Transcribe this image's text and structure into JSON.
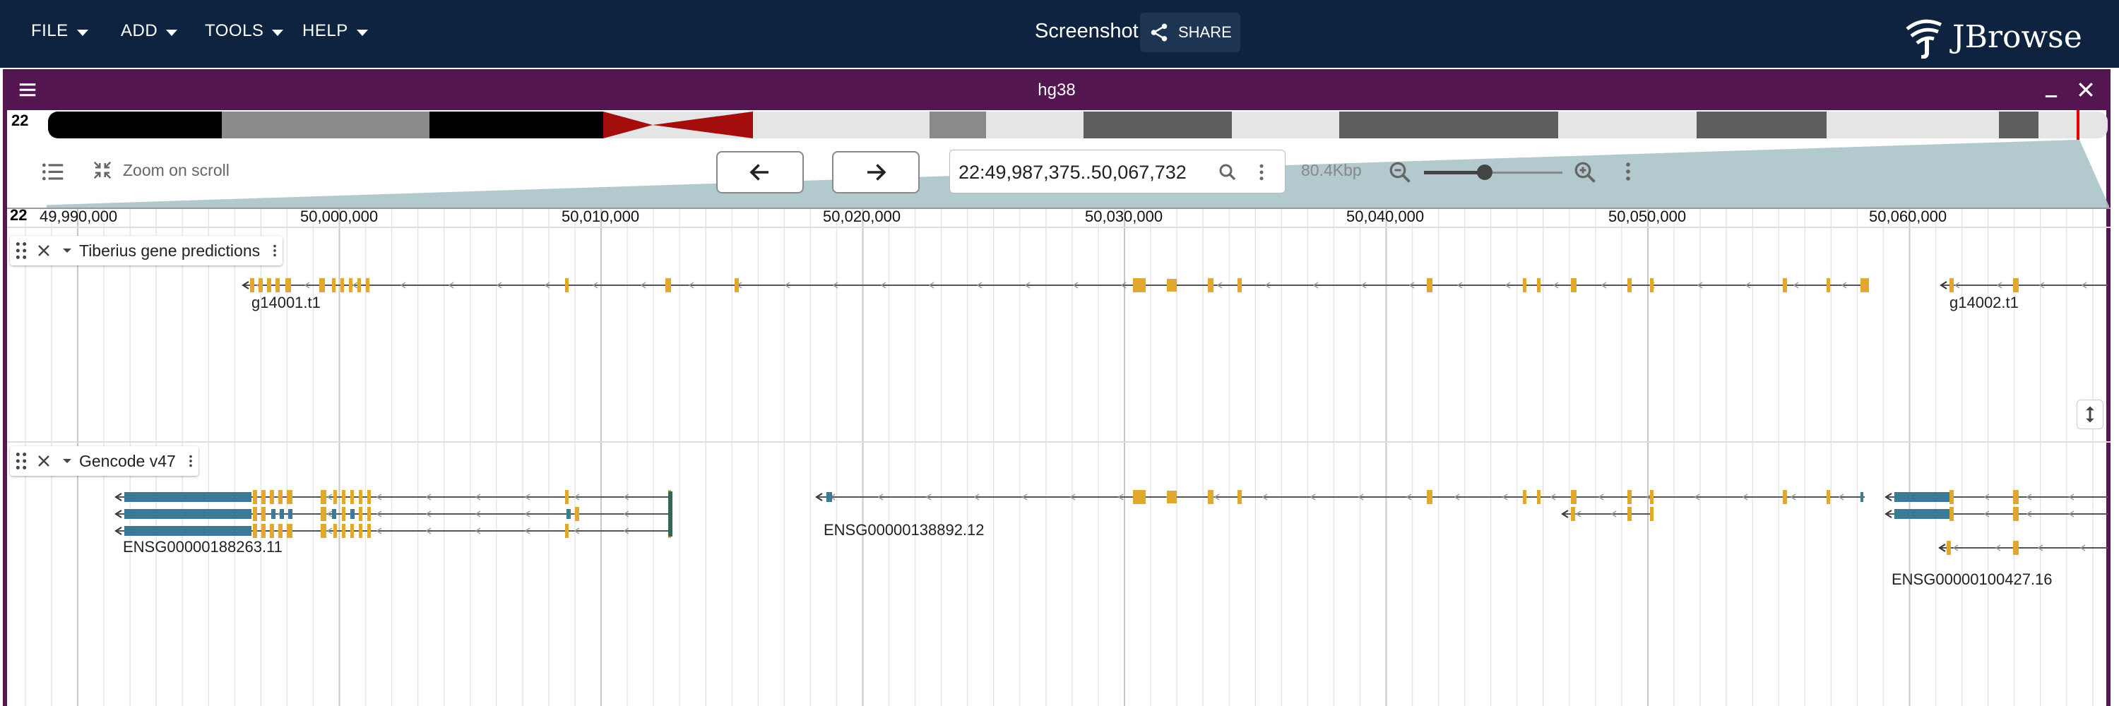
{
  "menus": [
    "FILE",
    "ADD",
    "TOOLS",
    "HELP"
  ],
  "session_name": "Screenshot",
  "share_label": "SHARE",
  "logo_text": "JBrowse",
  "view": {
    "assembly": "hg38",
    "chrom": "22",
    "zoom_on_scroll_label": "Zoom on scroll",
    "location": "22:49,987,375..50,067,732",
    "bp_label": "80.4Kbp",
    "zoom_level": 0.44
  },
  "ruler": {
    "chrom": "22",
    "ticks": [
      "49,990,000",
      "50,000,000",
      "50,010,000",
      "50,020,000",
      "50,030,000",
      "50,040,000",
      "50,050,000",
      "50,060,000"
    ]
  },
  "tracks": [
    {
      "name": "Tiberius gene predictions",
      "features": [
        "g14001.t1",
        "g14002.t1"
      ]
    },
    {
      "name": "Gencode v47",
      "features": [
        "ENSG00000188263.11",
        "ENSG00000138892.12",
        "ENSG00000100427.16"
      ]
    }
  ],
  "colors": {
    "appbar": "#0d233f",
    "view_header": "#541650",
    "exon": "#e0a82e",
    "utr": "#3b7a97",
    "centromere": "#a30d0d"
  }
}
